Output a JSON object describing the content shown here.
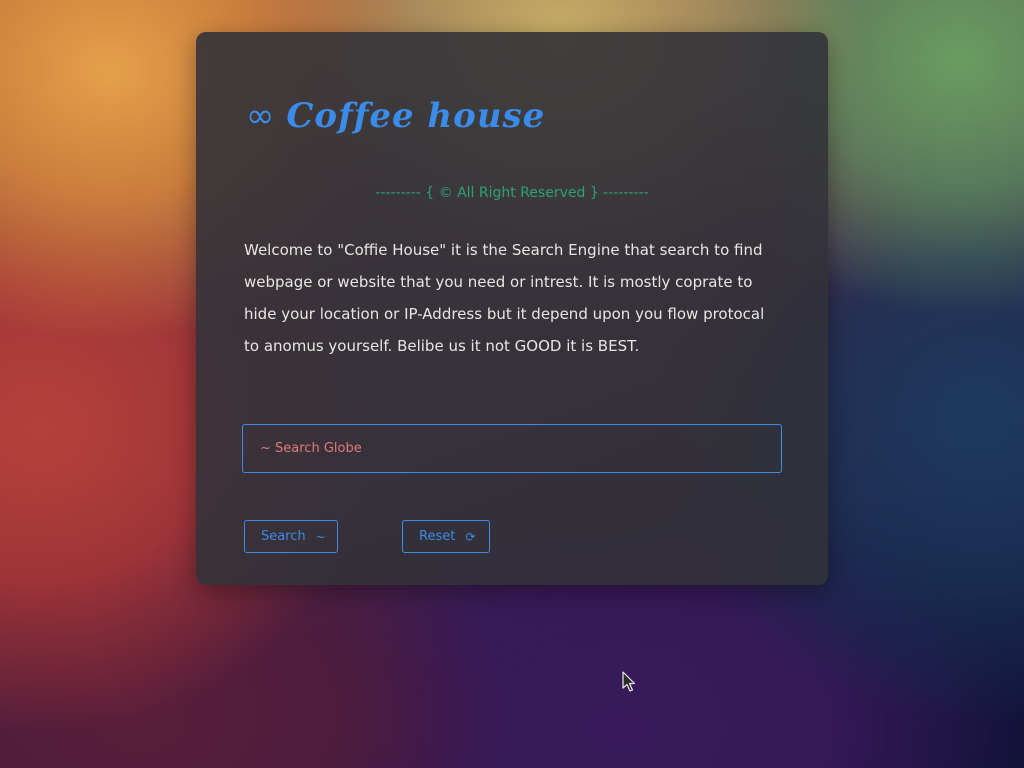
{
  "brand": {
    "icon": "∞",
    "title": "Coffee house"
  },
  "copyright": "--------- { © All Right Reserved } ---------",
  "welcome_text": "Welcome to \"Coffie House\" it is the Search Engine that search to find webpage or website that you need or intrest. It is mostly coprate to hide your location or IP-Address but it depend upon you flow protocal to anomus yourself. Belibe us it not GOOD it is BEST.",
  "search": {
    "placeholder": "~ Search Globe",
    "value": ""
  },
  "buttons": {
    "search_label": "Search",
    "search_glyph": "~",
    "reset_label": "Reset",
    "reset_glyph": "⟳"
  },
  "colors": {
    "accent": "#3b8be8",
    "copyright": "#2aa374",
    "placeholder": "#e07a7a",
    "card": "#323238"
  },
  "icons": {
    "brand": "infinity-icon",
    "reset": "refresh-icon",
    "cursor": "mouse-pointer-icon"
  }
}
